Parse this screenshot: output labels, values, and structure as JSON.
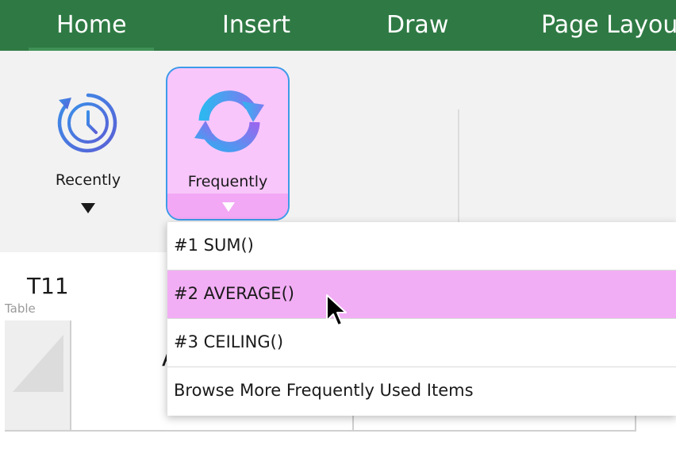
{
  "tabs": [
    {
      "label": "Home"
    },
    {
      "label": "Insert"
    },
    {
      "label": "Draw"
    },
    {
      "label": "Page Layout"
    }
  ],
  "ribbon": {
    "recently": {
      "label": "Recently",
      "icon": "clock-history-icon"
    },
    "frequently": {
      "label": "Frequently",
      "icon": "refresh-cycle-icon"
    }
  },
  "namebox": {
    "cell_ref": "T11",
    "caption": "Table"
  },
  "grid": {
    "visible_column_letter": "A"
  },
  "dropdown": {
    "items": [
      {
        "label": "#1 SUM()"
      },
      {
        "label": "#2 AVERAGE()"
      },
      {
        "label": "#3 CEILING()"
      },
      {
        "label": "Browse More Frequently Used Items"
      }
    ]
  },
  "colors": {
    "tab_bar": "#2f7a44",
    "frequently_bg": "#f8c6fb",
    "frequently_border": "#3d9be9",
    "selected_item": "#f2aef5"
  }
}
